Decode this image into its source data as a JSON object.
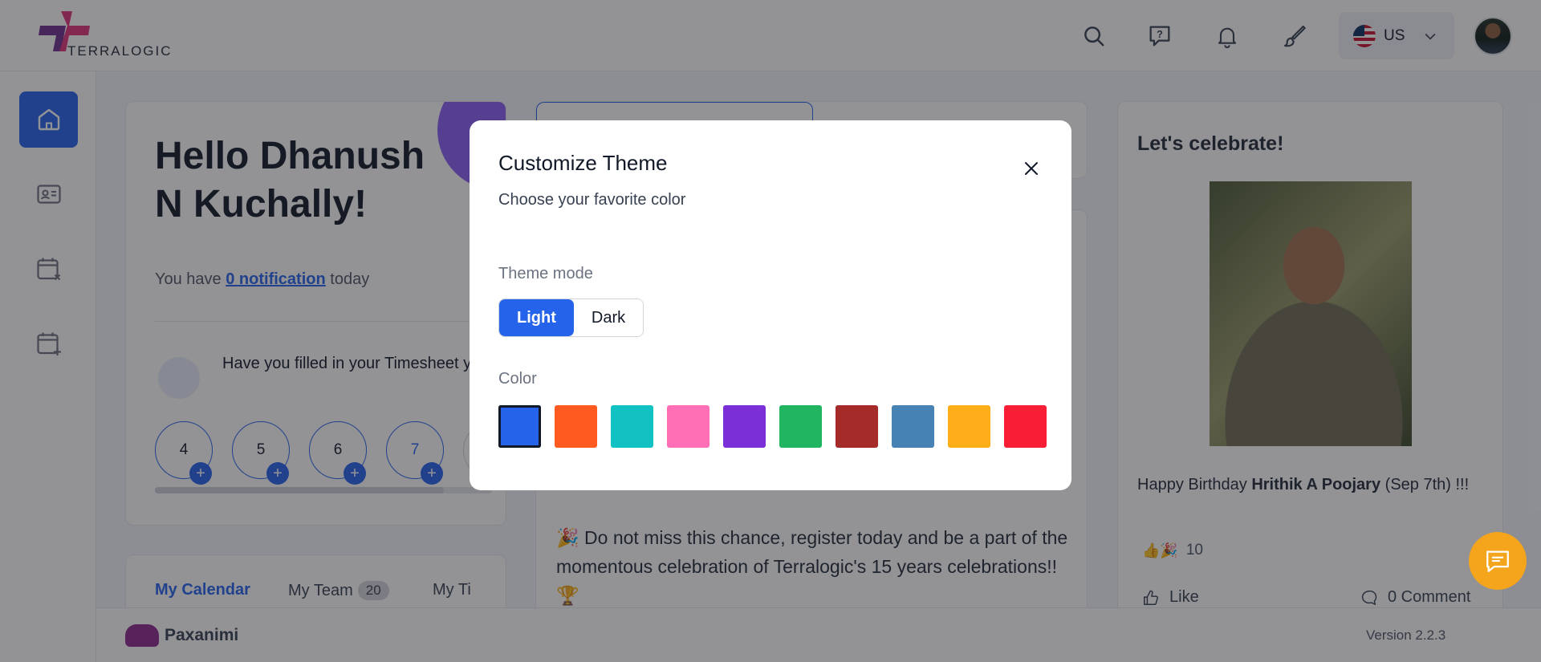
{
  "header": {
    "brand": "TERRALOGIC",
    "language": "US"
  },
  "welcome": {
    "greeting_line1": "Hello Dhanush",
    "greeting_line2": "N Kuchally!",
    "notif_prefix": "You have",
    "notif_link": "0 notification",
    "notif_suffix": "today",
    "timesheet_question": "Have you filled in your Timesheet yet?",
    "days": [
      "4",
      "5",
      "6",
      "7"
    ]
  },
  "calendar_tabs": {
    "my_calendar": "My Calendar",
    "my_team": "My Team",
    "my_team_count": "20",
    "my_third": "My Ti"
  },
  "announcement": {
    "text": "🎉 Do not miss this chance, register today and be a part of the momentous celebration of Terralogic's 15 years celebrations!! 🏆"
  },
  "celebrate": {
    "title": "Let's celebrate!",
    "birthday_prefix": "Happy Birthday",
    "birthday_name": "Hrithik A Poojary",
    "birthday_suffix": "(Sep 7th) !!!",
    "reaction_count": "10",
    "like_label": "Like",
    "comment_label": "0 Comment"
  },
  "footer": {
    "brand": "Paxanimi",
    "version": "Version 2.2.3"
  },
  "modal": {
    "title": "Customize Theme",
    "subtitle": "Choose your favorite color",
    "theme_mode_label": "Theme mode",
    "light": "Light",
    "dark": "Dark",
    "color_label": "Color",
    "colors": [
      "#2563eb",
      "#ff5a1f",
      "#12c2c2",
      "#ff6fb5",
      "#7b2fd6",
      "#21b562",
      "#a52a2a",
      "#4682b4",
      "#fdae19",
      "#f71e35"
    ],
    "selected_color": "#2563eb"
  },
  "icons": [
    "search-icon",
    "help-icon",
    "bell-icon",
    "paint-brush-icon",
    "chevron-down-icon",
    "home-icon",
    "profile-card-icon",
    "calendar-x-icon",
    "calendar-plus-icon",
    "close-icon",
    "thumbs-up-icon",
    "comment-icon",
    "feedback-icon"
  ]
}
